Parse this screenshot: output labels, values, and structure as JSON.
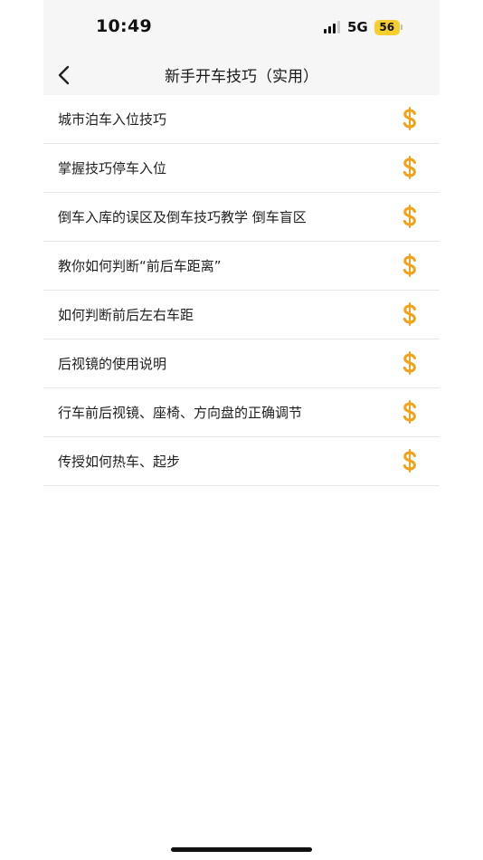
{
  "status_bar": {
    "time": "10:49",
    "network": "5G",
    "battery": "56"
  },
  "nav": {
    "back_icon": "chevron-left-icon",
    "title": "新手开车技巧（实用）"
  },
  "list": {
    "items": [
      {
        "label": "城市泊车入位技巧",
        "icon": "dollar-icon"
      },
      {
        "label": "掌握技巧停车入位",
        "icon": "dollar-icon"
      },
      {
        "label": "倒车入库的误区及倒车技巧教学 倒车盲区",
        "icon": "dollar-icon"
      },
      {
        "label": "教你如何判断“前后车距离”",
        "icon": "dollar-icon"
      },
      {
        "label": "如何判断前后左右车距",
        "icon": "dollar-icon"
      },
      {
        "label": "后视镜的使用说明",
        "icon": "dollar-icon"
      },
      {
        "label": "行车前后视镜、座椅、方向盘的正确调节",
        "icon": "dollar-icon"
      },
      {
        "label": "传授如何热车、起步",
        "icon": "dollar-icon"
      }
    ]
  },
  "colors": {
    "accent": "#f2a21a",
    "status_battery": "#f5cf2f"
  }
}
